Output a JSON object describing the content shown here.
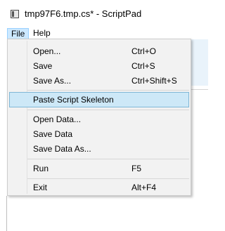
{
  "window": {
    "title": "tmp97F6.tmp.cs* - ScriptPad"
  },
  "menubar": {
    "file_label": "File",
    "help_label": "Help"
  },
  "file_menu": {
    "open": {
      "label": "Open...",
      "shortcut": "Ctrl+O"
    },
    "save": {
      "label": "Save",
      "shortcut": "Ctrl+S"
    },
    "save_as": {
      "label": "Save As...",
      "shortcut": "Ctrl+Shift+S"
    },
    "paste_skeleton": {
      "label": "Paste Script Skeleton"
    },
    "open_data": {
      "label": "Open Data..."
    },
    "save_data": {
      "label": "Save Data"
    },
    "save_data_as": {
      "label": "Save Data As..."
    },
    "run": {
      "label": "Run",
      "shortcut": "F5"
    },
    "exit": {
      "label": "Exit",
      "shortcut": "Alt+F4"
    },
    "highlighted_item": "Paste Script Skeleton"
  },
  "colors": {
    "menu_background": "#f2f2f2",
    "highlight": "#cde8f7",
    "highlight_border": "#7fb7d6",
    "menubar_active": "#cce8ff"
  }
}
